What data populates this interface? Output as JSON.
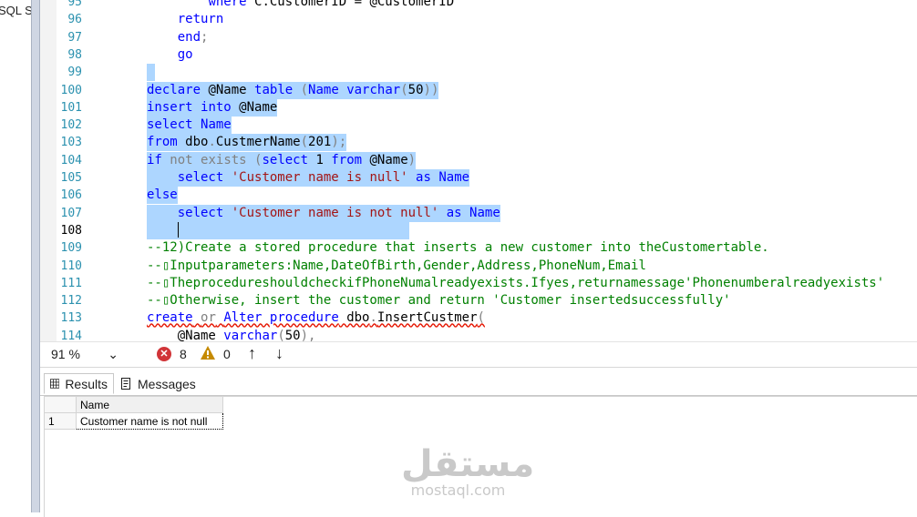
{
  "left_panel": {
    "text": "SQL S"
  },
  "editor": {
    "lines": [
      {
        "num": "95",
        "tokens": [
          {
            "t": "        ",
            "c": "id"
          },
          {
            "t": "where",
            "c": "kw"
          },
          {
            "t": " C.CustomerID = @CustomerID",
            "c": "id"
          }
        ]
      },
      {
        "num": "96",
        "tokens": [
          {
            "t": "    ",
            "c": "id"
          },
          {
            "t": "return",
            "c": "kw"
          }
        ]
      },
      {
        "num": "97",
        "tokens": [
          {
            "t": "    ",
            "c": "id"
          },
          {
            "t": "end",
            "c": "kw"
          },
          {
            "t": ";",
            "c": "gr"
          }
        ]
      },
      {
        "num": "98",
        "tokens": [
          {
            "t": "    ",
            "c": "id"
          },
          {
            "t": "go",
            "c": "kw"
          }
        ]
      },
      {
        "num": "99",
        "tokens": [
          {
            "t": "",
            "c": "id"
          }
        ]
      },
      {
        "num": "100",
        "tokens": [
          {
            "t": "declare",
            "c": "kw"
          },
          {
            "t": " @Name ",
            "c": "id"
          },
          {
            "t": "table",
            "c": "kw"
          },
          {
            "t": " (",
            "c": "gr"
          },
          {
            "t": "Name",
            "c": "kw"
          },
          {
            "t": " ",
            "c": "id"
          },
          {
            "t": "varchar",
            "c": "kw"
          },
          {
            "t": "(",
            "c": "gr"
          },
          {
            "t": "50",
            "c": "id"
          },
          {
            "t": "))",
            "c": "gr"
          }
        ]
      },
      {
        "num": "101",
        "tokens": [
          {
            "t": "insert",
            "c": "kw"
          },
          {
            "t": " ",
            "c": "id"
          },
          {
            "t": "into",
            "c": "kw"
          },
          {
            "t": " @Name",
            "c": "id"
          }
        ]
      },
      {
        "num": "102",
        "tokens": [
          {
            "t": "select",
            "c": "kw"
          },
          {
            "t": " ",
            "c": "id"
          },
          {
            "t": "Name",
            "c": "kw"
          }
        ]
      },
      {
        "num": "103",
        "tokens": [
          {
            "t": "from",
            "c": "kw"
          },
          {
            "t": " dbo",
            "c": "id"
          },
          {
            "t": ".",
            "c": "gr"
          },
          {
            "t": "CustmerName",
            "c": "id"
          },
          {
            "t": "(",
            "c": "gr"
          },
          {
            "t": "201",
            "c": "id"
          },
          {
            "t": ");",
            "c": "gr"
          }
        ]
      },
      {
        "num": "104",
        "tokens": [
          {
            "t": "if",
            "c": "kw"
          },
          {
            "t": " ",
            "c": "id"
          },
          {
            "t": "not",
            "c": "gr"
          },
          {
            "t": " ",
            "c": "id"
          },
          {
            "t": "exists",
            "c": "gr"
          },
          {
            "t": " (",
            "c": "gr"
          },
          {
            "t": "select",
            "c": "kw"
          },
          {
            "t": " 1 ",
            "c": "id"
          },
          {
            "t": "from",
            "c": "kw"
          },
          {
            "t": " @Name",
            "c": "id"
          },
          {
            "t": ")",
            "c": "gr"
          }
        ]
      },
      {
        "num": "105",
        "tokens": [
          {
            "t": "    ",
            "c": "id"
          },
          {
            "t": "select",
            "c": "kw"
          },
          {
            "t": " ",
            "c": "id"
          },
          {
            "t": "'Customer name is null'",
            "c": "str"
          },
          {
            "t": " ",
            "c": "id"
          },
          {
            "t": "as",
            "c": "kw"
          },
          {
            "t": " ",
            "c": "id"
          },
          {
            "t": "Name",
            "c": "kw"
          }
        ]
      },
      {
        "num": "106",
        "tokens": [
          {
            "t": "else",
            "c": "kw"
          }
        ]
      },
      {
        "num": "107",
        "tokens": [
          {
            "t": "    ",
            "c": "id"
          },
          {
            "t": "select",
            "c": "kw"
          },
          {
            "t": " ",
            "c": "id"
          },
          {
            "t": "'Customer name is not null'",
            "c": "str"
          },
          {
            "t": " ",
            "c": "id"
          },
          {
            "t": "as",
            "c": "kw"
          },
          {
            "t": " ",
            "c": "id"
          },
          {
            "t": "Name",
            "c": "kw"
          }
        ]
      },
      {
        "num": "108",
        "tokens": [
          {
            "t": "    ",
            "c": "id"
          }
        ],
        "caret": true
      },
      {
        "num": "109",
        "tokens": [
          {
            "t": "--12)Create a stored procedure that inserts a new customer into theCustomertable.",
            "c": "cm"
          }
        ]
      },
      {
        "num": "110",
        "tokens": [
          {
            "t": "--▯Inputparameters:Name,DateOfBirth,Gender,Address,PhoneNum,Email",
            "c": "cm"
          }
        ]
      },
      {
        "num": "111",
        "tokens": [
          {
            "t": "--▯TheprocedureshouldcheckifPhoneNumalreadyexists.Ifyes,returnamessage'Phonenumberalreadyexists'",
            "c": "cm"
          }
        ]
      },
      {
        "num": "112",
        "tokens": [
          {
            "t": "--▯Otherwise, insert the customer and return 'Customer insertedsuccessfully'",
            "c": "cm"
          }
        ]
      },
      {
        "num": "113",
        "tokens": [
          {
            "t": "create",
            "c": "kw"
          },
          {
            "t": " ",
            "c": "id"
          },
          {
            "t": "or",
            "c": "gr"
          },
          {
            "t": " ",
            "c": "id"
          },
          {
            "t": "Alter",
            "c": "kw"
          },
          {
            "t": " ",
            "c": "id"
          },
          {
            "t": "procedure",
            "c": "kw"
          },
          {
            "t": " dbo",
            "c": "id"
          },
          {
            "t": ".",
            "c": "gr"
          },
          {
            "t": "InsertCustmer",
            "c": "id"
          },
          {
            "t": "(",
            "c": "gr"
          }
        ],
        "error": true
      },
      {
        "num": "114",
        "tokens": [
          {
            "t": "    @Name ",
            "c": "id"
          },
          {
            "t": "varchar",
            "c": "kw"
          },
          {
            "t": "(",
            "c": "gr"
          },
          {
            "t": "50",
            "c": "id"
          },
          {
            "t": "),",
            "c": "gr"
          }
        ]
      }
    ]
  },
  "status": {
    "zoom": "91 %",
    "error_count": "8",
    "warning_count": "0",
    "error_icon_glyph": "✕",
    "up_glyph": "↑",
    "down_glyph": "↓",
    "dropdown_glyph": "⌄"
  },
  "results": {
    "tabs": [
      {
        "label": "Results"
      },
      {
        "label": "Messages"
      }
    ],
    "columns": [
      "Name"
    ],
    "rows": [
      {
        "num": "1",
        "values": [
          "Customer name is not null"
        ]
      }
    ]
  },
  "watermark": {
    "arabic": "مستقل",
    "latin": "mostaql.com"
  }
}
